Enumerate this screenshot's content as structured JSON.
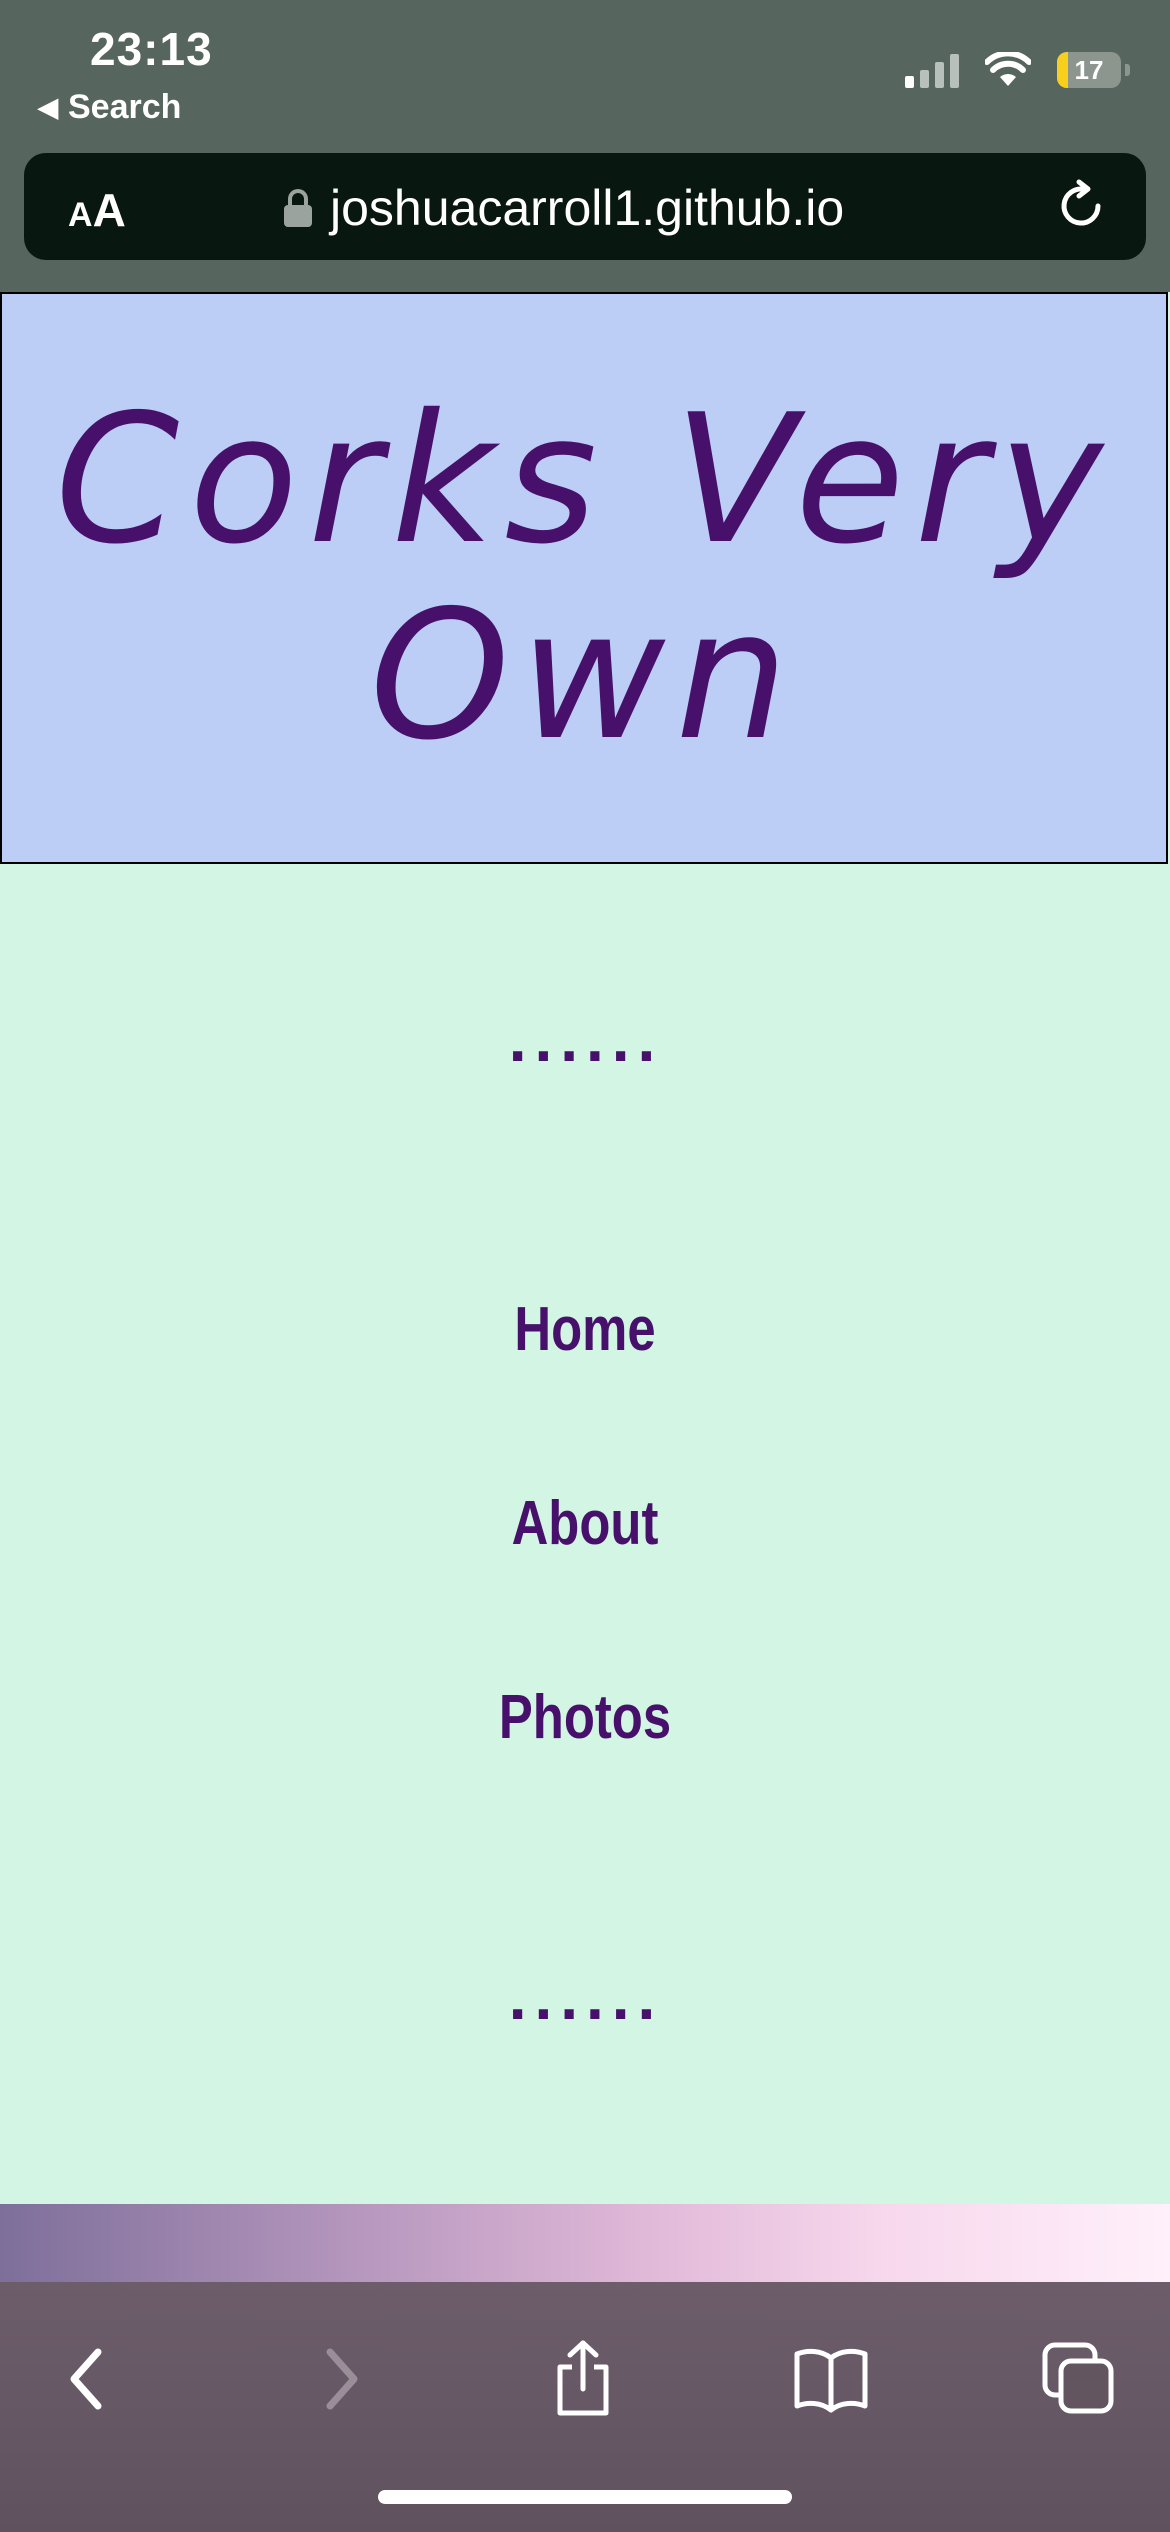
{
  "status_bar": {
    "time": "23:13",
    "back_app": "Search",
    "battery": "17",
    "battery_level": 0.17
  },
  "browser": {
    "text_size_small": "A",
    "text_size_big": "A",
    "url": "joshuacarroll1.github.io"
  },
  "site": {
    "title": "Corks Very Own",
    "divider_top": "......",
    "nav": [
      "Home",
      "About",
      "Photos"
    ],
    "divider_bottom": "......"
  },
  "colors": {
    "banner_bg": "#bccdf6",
    "page_bg": "#d3f5e3",
    "accent_purple": "#47116b"
  }
}
